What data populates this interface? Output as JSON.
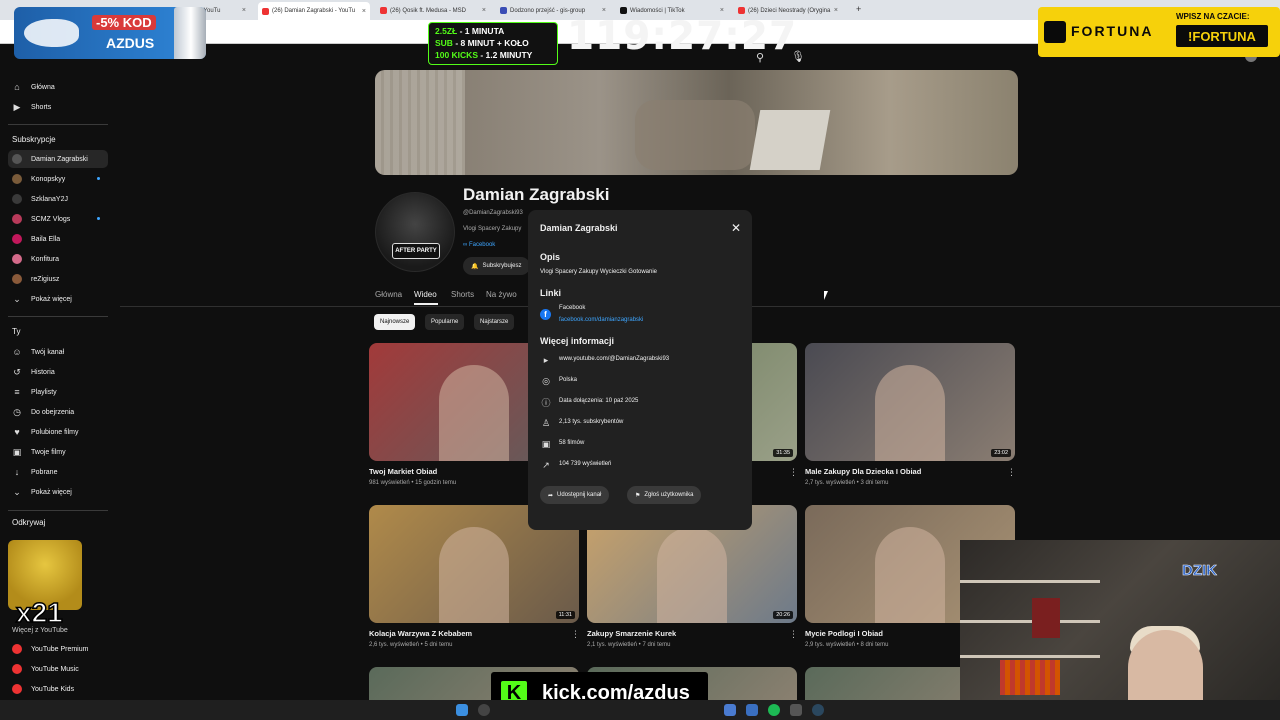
{
  "browser": {
    "tabs": [
      {
        "label": "ki · YouTu",
        "color": "#e33"
      },
      {
        "label": "(26) Damian Zagrabski - YouTu",
        "color": "#e33",
        "active": true
      },
      {
        "label": "(26) Qosik ft. Medusa - MSD",
        "color": "#e33"
      },
      {
        "label": "Dodzono przejść - gis-group",
        "color": "#3a4db5"
      },
      {
        "label": "Wiadomości | TikTok",
        "color": "#111"
      },
      {
        "label": "(26) Dzieci Neostrady (Orygina",
        "color": "#e33"
      }
    ]
  },
  "sidebar": {
    "main": [
      {
        "label": "Główna",
        "icon": "home-icon"
      },
      {
        "label": "Shorts",
        "icon": "shorts-icon"
      }
    ],
    "subs_heading": "Subskrypcje",
    "subs": [
      {
        "label": "Damian Zagrabski",
        "color": "#555",
        "active": true
      },
      {
        "label": "Konopskyy",
        "color": "#7a5b3a",
        "dot": true
      },
      {
        "label": "SzklanaY2J",
        "color": "#3a3a3a"
      },
      {
        "label": "SCMZ Vlogs",
        "color": "#b83a5a",
        "dot": true
      },
      {
        "label": "Baila Ella",
        "color": "#c2185b"
      },
      {
        "label": "Konfitura",
        "color": "#d46a8a"
      },
      {
        "label": "reZigiusz",
        "color": "#8a5a3a"
      },
      {
        "label": "Pokaż więcej",
        "chevron": true
      }
    ],
    "you_heading": "Ty",
    "you": [
      {
        "label": "Twój kanał",
        "icon": "account-icon"
      },
      {
        "label": "Historia",
        "icon": "history-icon"
      },
      {
        "label": "Playlisty",
        "icon": "playlist-icon"
      },
      {
        "label": "Do obejrzenia",
        "icon": "watch-later-icon"
      },
      {
        "label": "Polubione filmy",
        "icon": "like-icon"
      },
      {
        "label": "Twoje filmy",
        "icon": "video-icon"
      },
      {
        "label": "Pobrane",
        "icon": "download-icon"
      },
      {
        "label": "Pokaż więcej",
        "icon": "chevron-down-icon"
      }
    ],
    "explore_heading": "Odkrywaj",
    "more_heading": "Więcej z YouTube",
    "more": [
      {
        "label": "YouTube Premium",
        "color": "#e33"
      },
      {
        "label": "YouTube Music",
        "color": "#e33"
      },
      {
        "label": "YouTube Kids",
        "color": "#e33"
      }
    ]
  },
  "channel": {
    "name": "Damian Zagrabski",
    "handle": "@DamianZagrabski93",
    "description": "Vlogi Spacery Zakupy",
    "link": "Facebook",
    "subscribe_label": "Subskrybujesz",
    "tabs": [
      "Główna",
      "Wideo",
      "Shorts",
      "Na żywo"
    ],
    "active_tab": "Wideo",
    "chips": [
      "Najnowsze",
      "Popularne",
      "Najstarsze"
    ]
  },
  "videos": [
    {
      "title": "Twoj Markiet Obiad",
      "meta": "981 wyświetleń • 15 godzin temu",
      "duration": "",
      "color1": "#a23a3a",
      "color2": "#5e5e5e"
    },
    {
      "title": "",
      "meta": "",
      "duration": "31:35",
      "color1": "#6b7a5a",
      "color2": "#9aa088"
    },
    {
      "title": "Male Zakupy Dla Dziecka I Obiad",
      "meta": "2,7 tys. wyświetleń • 3 dni temu",
      "duration": "23:02",
      "color1": "#4a4a52",
      "color2": "#8a7d72"
    },
    {
      "title": "Kolacja Warzywa Z Kebabem",
      "meta": "2,6 tys. wyświetleń • 5 dni temu",
      "duration": "11:31",
      "color1": "#b08a4a",
      "color2": "#6a5a4a"
    },
    {
      "title": "Zakupy Smarzenie Kurek",
      "meta": "2,1 tys. wyświetleń • 7 dni temu",
      "duration": "20:26",
      "color1": "#c9a26a",
      "color2": "#6d7a8a"
    },
    {
      "title": "Mycie Podlogi I Obiad",
      "meta": "2,9 tys. wyświetleń • 8 dni temu",
      "duration": "",
      "color1": "#7a6a5a",
      "color2": "#a89274"
    }
  ],
  "about": {
    "title": "Damian Zagrabski",
    "desc_heading": "Opis",
    "desc": "Vlogi Spacery Zakupy Wycieczki Gotowanie",
    "links_heading": "Linki",
    "link_name": "Facebook",
    "link_url": "facebook.com/damianzagrabski",
    "info_heading": "Więcej informacji",
    "info": [
      {
        "text": "www.youtube.com/@DamianZagrabski93",
        "icon": "globe-link-icon"
      },
      {
        "text": "Polska",
        "icon": "globe-icon"
      },
      {
        "text": "Data dołączenia: 10 paź 2025",
        "icon": "info-icon"
      },
      {
        "text": "2,13 tys. subskrybentów",
        "icon": "subscribers-icon"
      },
      {
        "text": "58 filmów",
        "icon": "video-icon"
      },
      {
        "text": "104 739 wyświetleń",
        "icon": "trending-icon"
      }
    ],
    "share_label": "Udostępnij kanał",
    "report_label": "Zgłoś użytkownika"
  },
  "overlays": {
    "promo_discount": "-5% KOD",
    "promo_code": "AZDUS",
    "kick_lines": [
      {
        "lead": "2.5ZŁ",
        "rest": " - 1 MINUTA"
      },
      {
        "lead": "SUB",
        "rest": " - 8 MINUT + KOŁO"
      },
      {
        "lead": "100 KICKS",
        "rest": " - 1.2 MINUTY"
      }
    ],
    "timer": "119:27:27",
    "fortuna_logo": "FORTUNA",
    "fortuna_note": "WPISZ NA CZACIE:",
    "fortuna_code": "!FORTUNA",
    "emote_count": "x21",
    "cam_logo": "DZIK",
    "kick_url": "kick.com/azdus"
  }
}
